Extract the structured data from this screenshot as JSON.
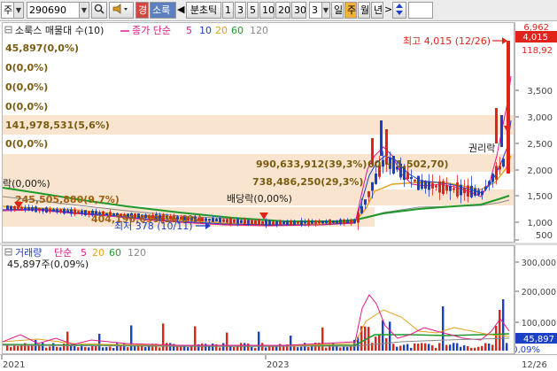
{
  "toolbar": {
    "market": "주",
    "code": "290690",
    "gyeong": "경",
    "name": "소룩",
    "left_arrow": "◀",
    "min_tick": "분초틱",
    "periods": [
      "1",
      "3",
      "5",
      "10",
      "20",
      "30"
    ],
    "count": "3",
    "day": "일",
    "week": "주",
    "month": "월",
    "year": "년",
    "next": ">"
  },
  "main_legend": {
    "title": "소룩스 매물대 수(10)",
    "ma_label": "종가 단순",
    "ma_periods": [
      "5",
      "10",
      "20",
      "60",
      "120"
    ],
    "ma_colors": [
      "#e0188a",
      "#1d3ec8",
      "#e0a21a",
      "#1f9a2a",
      "#888888"
    ]
  },
  "price_labels": {
    "close": "45,897(0,0%)",
    "row2": "0(0,0%)",
    "row3": "0(0,0%)",
    "row4": "0(0,0%)",
    "band_low": "141,978,531(5,6%)",
    "row6": "0(0,0%)",
    "band_top": "990,633,912(39,3%)",
    "band_top_range": "60 ~ 1,502,70)",
    "band_mid": "738,486,250(29,3%)",
    "band_3": "245,505,880(9,7%)",
    "band_4": "404,196,639(16,0%)",
    "rak": "락(0,00%)",
    "baedang": "배당락(0,00%)",
    "gwonri": "권리락",
    "high_note": "최고 4,015 (12/26)",
    "low_note": "최저 378 (10/11)"
  },
  "price_axis": {
    "ticks": [
      "3,500",
      "3,000",
      "2,500",
      "2,000",
      "1,500",
      "1,000",
      "500"
    ],
    "top_values": [
      "6,962",
      "4,015",
      "118,92"
    ]
  },
  "volume_legend": {
    "title": "거래량",
    "ma_label": "단순",
    "ma_periods": [
      "5",
      "20",
      "60",
      "120"
    ],
    "ma_colors": [
      "#e0188a",
      "#e0a21a",
      "#1f9a2a",
      "#888888"
    ],
    "value": "45,897주(0,09%)"
  },
  "volume_axis": {
    "ticks": [
      "300,000",
      "200,000",
      "100,000"
    ],
    "current": "45,897",
    "pct": "0,09%"
  },
  "date_axis": {
    "start": "2021",
    "mid": "2023",
    "end": "12/26"
  },
  "colors": {
    "up": "#e2231a",
    "down": "#1c40c6",
    "band": "#f8e4cf",
    "label": "#7a5c10"
  }
}
